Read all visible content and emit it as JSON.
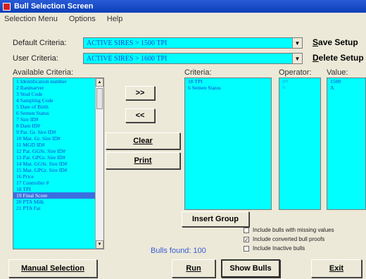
{
  "window": {
    "title": "Bull Selection Screen"
  },
  "menu": [
    "Selection Menu",
    "Options",
    "Help"
  ],
  "default_criteria": {
    "label": "Default Criteria:",
    "value": "ACTIVE SIRES > 1500 TPI"
  },
  "user_criteria": {
    "label": "User Criteria:",
    "value": "ACTIVE SIRES > 1600 TPI"
  },
  "save_setup": {
    "first": "S",
    "rest": "ave Setup"
  },
  "delete_setup": {
    "first": "D",
    "rest": "elete Setup"
  },
  "available": {
    "label": "Available Criteria:",
    "items": [
      "1 Identification number",
      "2 Ranmarver",
      "3 Stud Code",
      "4 Sampling Code",
      "5 Date of Birth",
      "6 Semen Status",
      "7 Sire ID#",
      "8 Dam ID#",
      "9 Pat. Gr. Sire ID#",
      "10 Mat. Gr. Sire ID#",
      "11 MGD ID#",
      "12 Pat. GGSr. Sire ID#",
      "13 Pat. GPGr. Sire ID#",
      "14 Mat. GGSr. Sire ID#",
      "15 Mat. GPGr. Sire ID#",
      "16 Price",
      "17 Controller #",
      "18 TPI",
      "19 Final Score",
      "20 PTA Milk",
      "21 PTA Fat"
    ],
    "selected_index": 18
  },
  "buttons": {
    "add": ">>",
    "remove": "<<",
    "clear": "Clear",
    "print": "Print",
    "insert_group": "Insert Group",
    "manual_selection": "Manual Selection",
    "run": "Run",
    "show_bulls": "Show Bulls",
    "exit": "Exit"
  },
  "criteria": {
    "label": "Criteria:",
    "items": [
      "18 TPI",
      "6 Semen Status"
    ]
  },
  "operator": {
    "label": "Operator:",
    "items": [
      ">=",
      "="
    ]
  },
  "value": {
    "label": "Value:",
    "items": [
      "1500",
      "A"
    ]
  },
  "checkboxes": [
    {
      "label": "Include bulls with missing values",
      "checked": false
    },
    {
      "label": "Include converted bull proofs",
      "checked": true
    },
    {
      "label": "Include Inactive bulls",
      "checked": false
    }
  ],
  "bulls_found": "Bulls found: 100",
  "colors": {
    "list_bg": "#00ffff",
    "list_text": "#1a3fc8",
    "title_bar": "#0a3fb8"
  }
}
